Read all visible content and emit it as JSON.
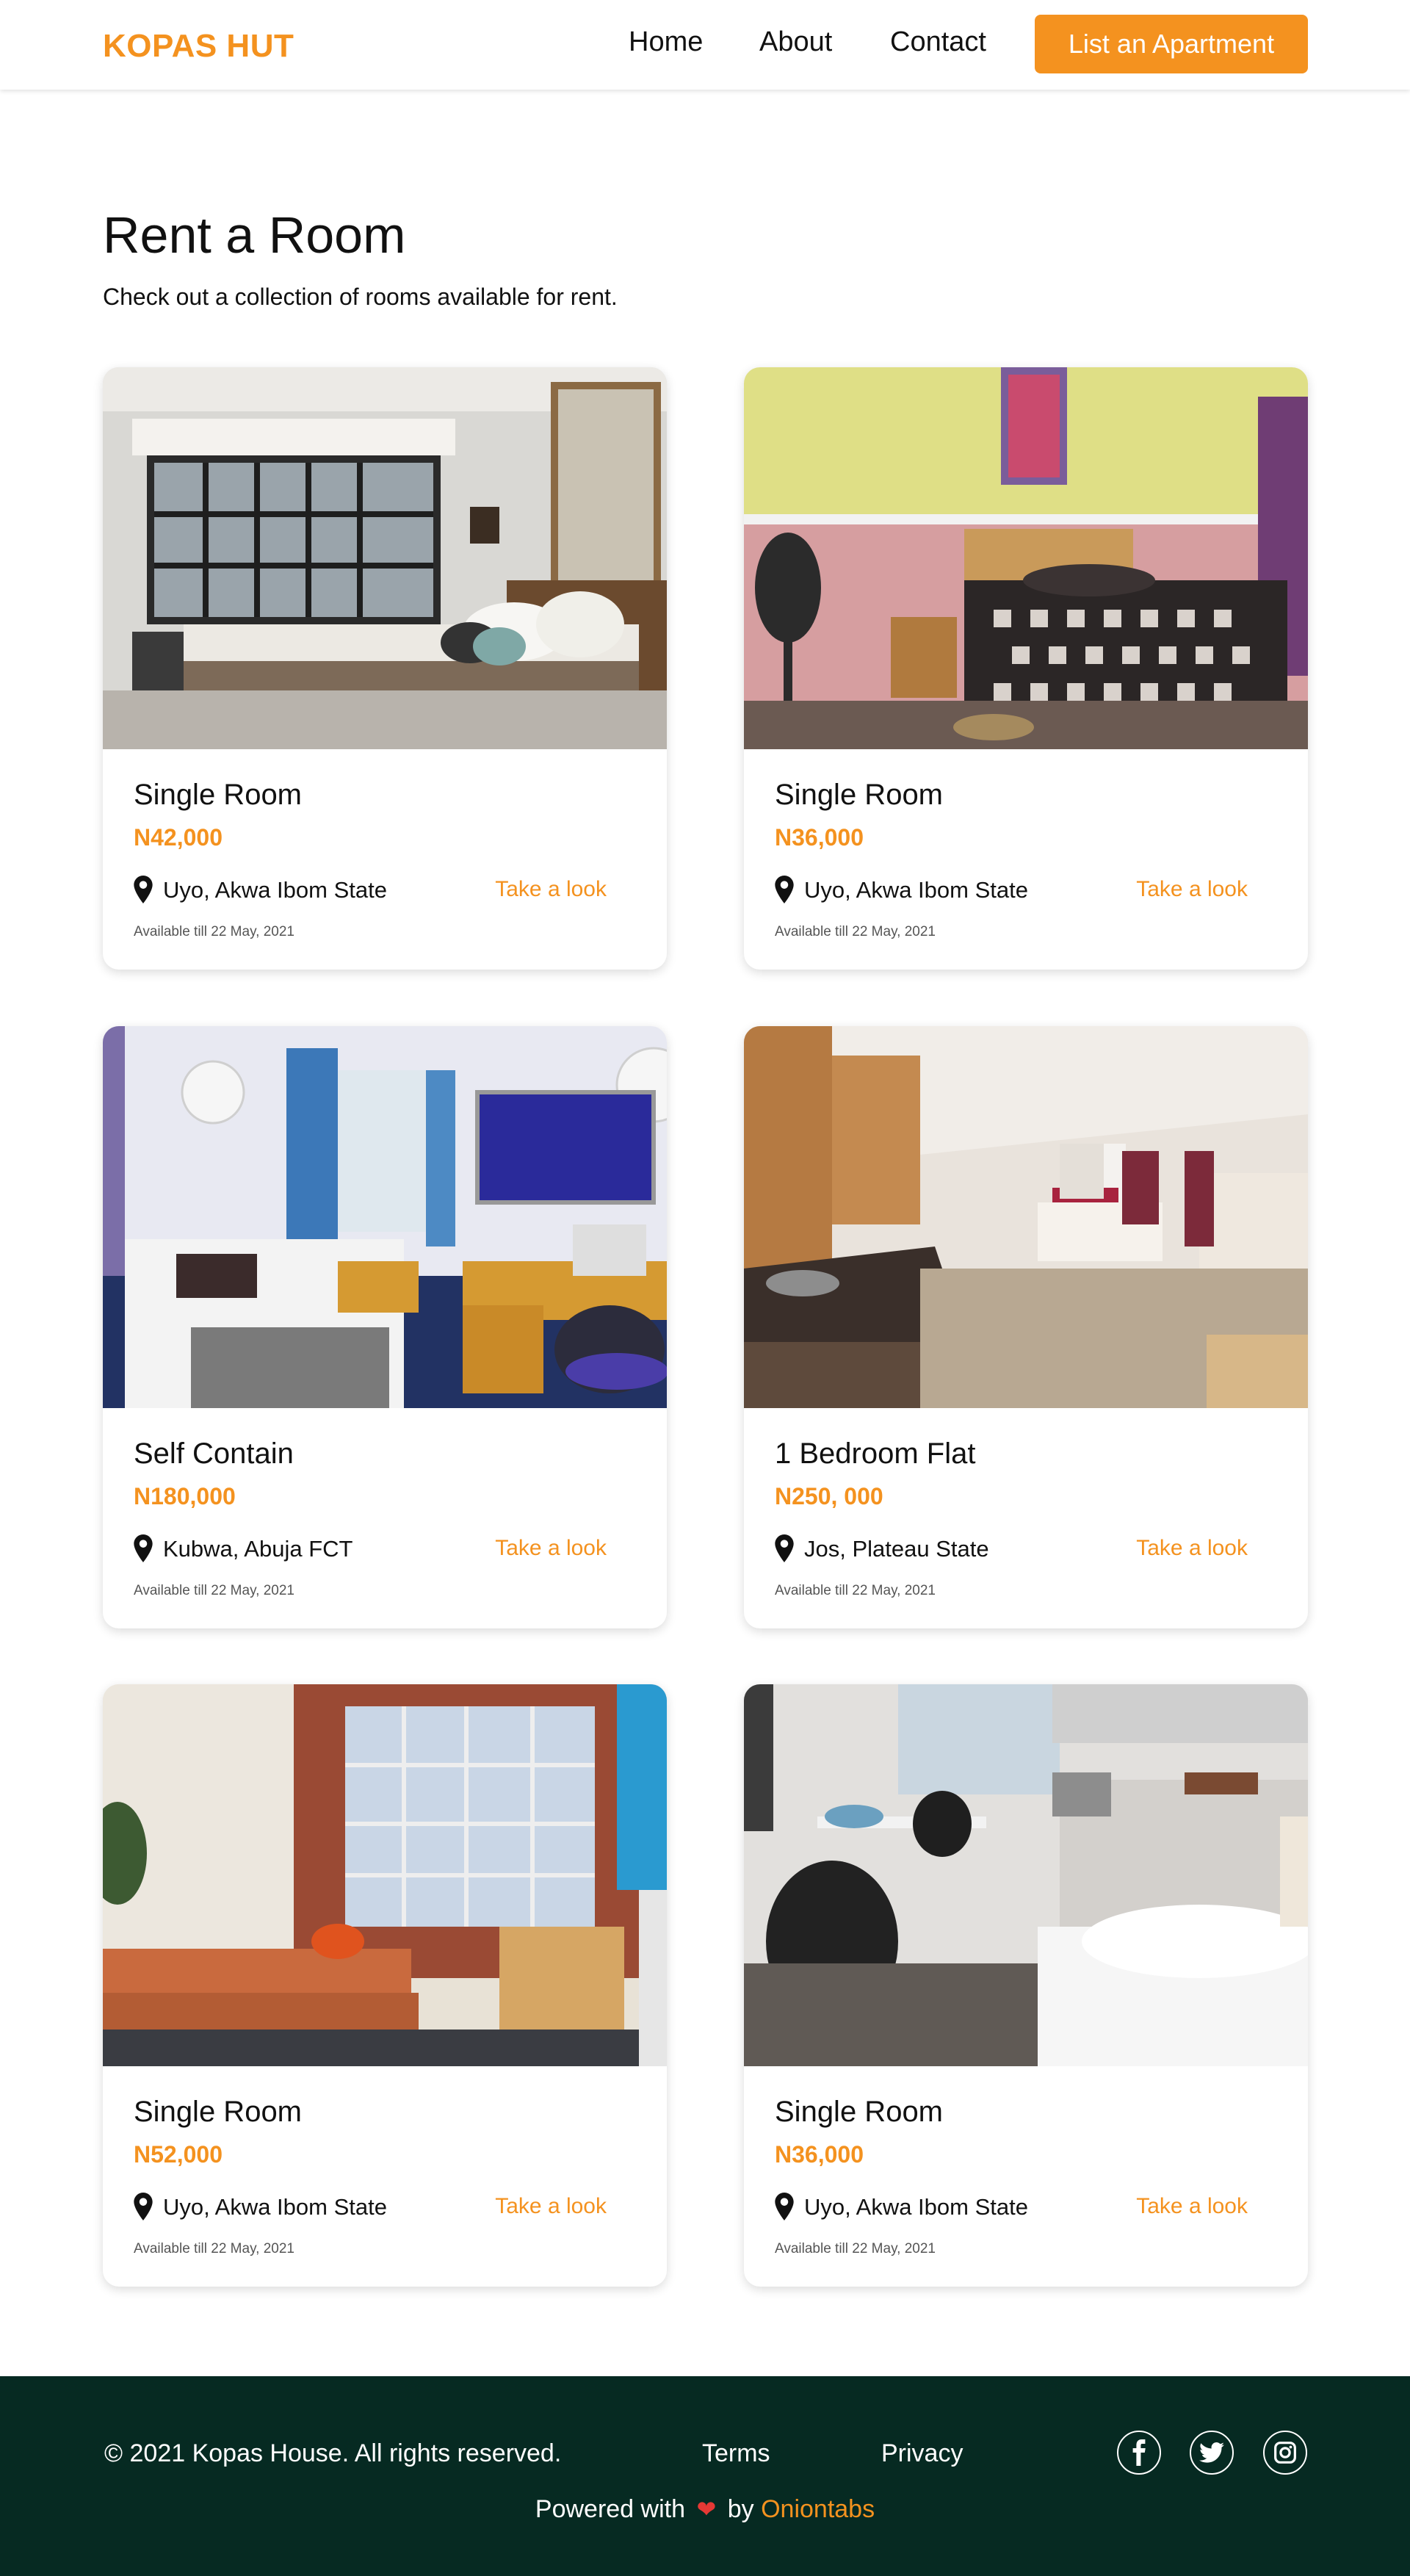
{
  "header": {
    "logo": "KOPAS HUT",
    "nav": {
      "home": "Home",
      "about": "About",
      "contact": "Contact"
    },
    "cta_label": "List an Apartment"
  },
  "intro": {
    "title": "Rent a Room",
    "subtitle": "Check out a collection of rooms available for rent."
  },
  "listings": [
    {
      "title": "Single Room",
      "price": "N42,000",
      "location": "Uyo, Akwa Ibom State",
      "link": "Take a look",
      "availability": "Available till 22 May, 2021",
      "photo": "bedroom-window-photo"
    },
    {
      "title": "Single Room",
      "price": "N36,000",
      "location": "Uyo, Akwa Ibom State",
      "link": "Take a look",
      "availability": "Available till 22 May, 2021",
      "photo": "pink-bedroom-photo"
    },
    {
      "title": "Self Contain",
      "price": "N180,000",
      "location": "Kubwa, Abuja FCT",
      "link": "Take a look",
      "availability": "Available till 22 May, 2021",
      "photo": "student-room-photo"
    },
    {
      "title": "1 Bedroom Flat",
      "price": "N250, 000",
      "location": "Jos, Plateau State",
      "link": "Take a look",
      "availability": "Available till 22 May, 2021",
      "photo": "studio-flat-photo"
    },
    {
      "title": "Single Room",
      "price": "N52,000",
      "location": "Uyo, Akwa Ibom State",
      "link": "Take a look",
      "availability": "Available till 22 May, 2021",
      "photo": "brick-wall-room-photo"
    },
    {
      "title": "Single Room",
      "price": "N36,000",
      "location": "Uyo, Akwa Ibom State",
      "link": "Take a look",
      "availability": "Available till 22 May, 2021",
      "photo": "modern-studio-photo"
    }
  ],
  "footer": {
    "copyright": "© 2021 Kopas House. All rights reserved.",
    "terms": "Terms",
    "privacy": "Privacy",
    "social_icons": [
      "facebook-icon",
      "twitter-icon",
      "instagram-icon"
    ],
    "powered_prefix": "Powered with",
    "powered_by": "by",
    "powered_brand": "Oniontabs"
  },
  "colors": {
    "accent": "#F4921F",
    "footer_bg": "#062A22",
    "heart": "#E53935"
  }
}
